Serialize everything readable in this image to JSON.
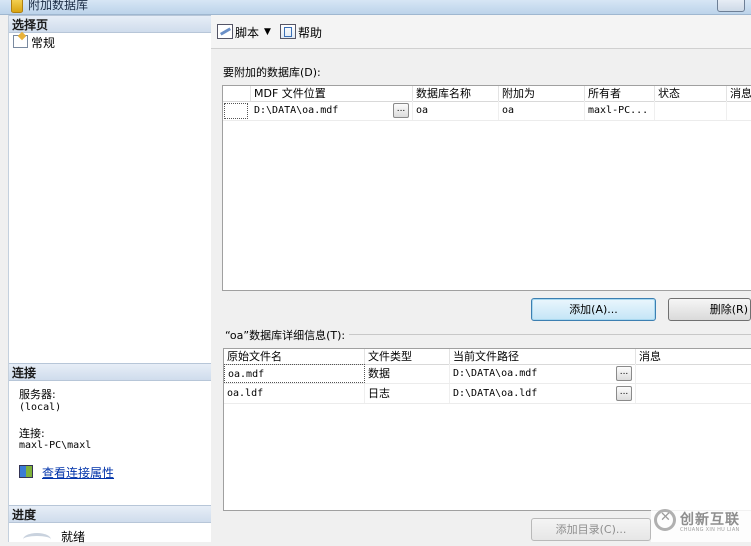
{
  "window": {
    "title": "附加数据库"
  },
  "left_pane": {
    "pages_header": "选择页",
    "pages": [
      {
        "label": "常规",
        "icon": "general-page-icon"
      }
    ],
    "connection_header": "连接",
    "server_label": "服务器:",
    "server_value": "(local)",
    "connection_label": "连接:",
    "connection_value": "maxl-PC\\maxl",
    "view_properties_link": "查看连接属性",
    "progress_header": "进度",
    "progress_status": "就绪"
  },
  "toolbar": {
    "script_label": "脚本",
    "help_label": "帮助"
  },
  "databases": {
    "label": "要附加的数据库(D):",
    "columns": [
      "MDF 文件位置",
      "数据库名称",
      "附加为",
      "所有者",
      "状态",
      "消息"
    ],
    "rows": [
      {
        "mdf": "D:\\DATA\\oa.mdf",
        "ellipsis": "...",
        "name": "oa",
        "attach_as": "oa",
        "owner": "maxl-PC...",
        "status": "",
        "message": ""
      }
    ],
    "add_button": "添加(A)...",
    "remove_button": "删除(R)"
  },
  "details": {
    "label": "“oa”数据库详细信息(T):",
    "columns": [
      "原始文件名",
      "文件类型",
      "当前文件路径",
      "消息"
    ],
    "rows": [
      {
        "file": "oa.mdf",
        "type": "数据",
        "path": "D:\\DATA\\oa.mdf",
        "ellipsis": "...",
        "message": ""
      },
      {
        "file": "oa.ldf",
        "type": "日志",
        "path": "D:\\DATA\\oa.ldf",
        "ellipsis": "...",
        "message": ""
      }
    ],
    "add_catalog_button": "添加目录(C)..."
  },
  "watermark": {
    "text": "创新互联",
    "sub": "CHUANG XIN HU LIAN"
  },
  "colors": {
    "link": "#0033aa",
    "default_button_border": "#3c7fb1",
    "section_header": "#cfdcec"
  }
}
